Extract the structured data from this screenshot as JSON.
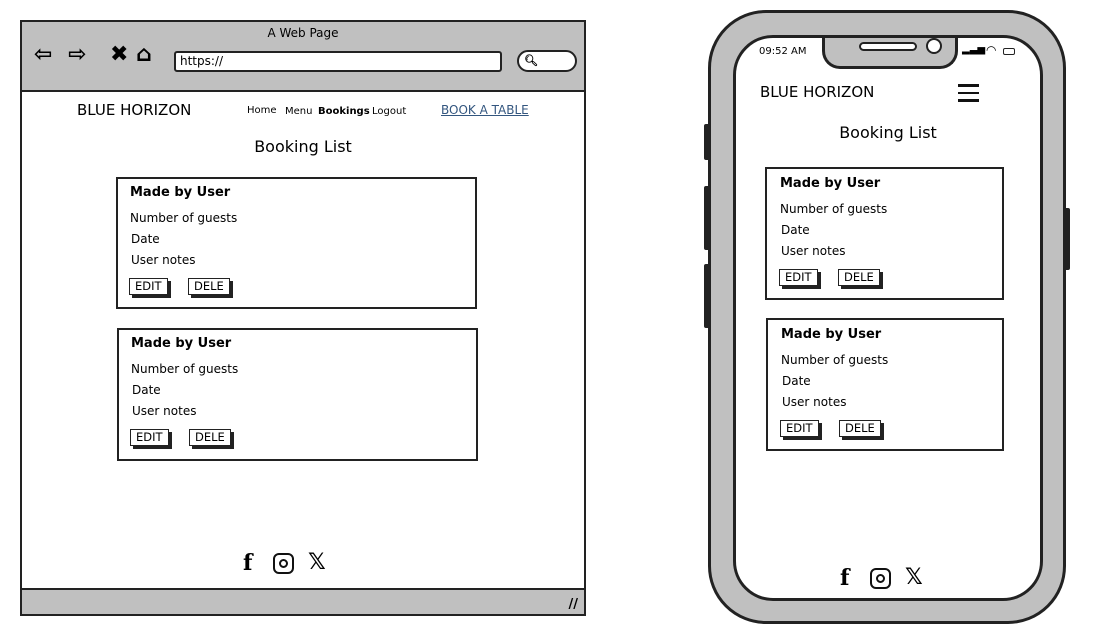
{
  "desktop": {
    "window_title": "A Web Page",
    "url": "https://",
    "nav": {
      "brand": "BLUE HORIZON",
      "links": [
        "Home",
        "Menu",
        "Bookings",
        "Logout"
      ],
      "cta": "BOOK A TABLE"
    },
    "page_title": "Booking List",
    "bookings": [
      {
        "title": "Made by User",
        "guests": "Number of guests",
        "date": "Date",
        "notes": "User notes",
        "edit": "EDIT",
        "delete": "DELE"
      },
      {
        "title": "Made by User",
        "guests": "Number of guests",
        "date": "Date",
        "notes": "User notes",
        "edit": "EDIT",
        "delete": "DELE"
      }
    ],
    "social": [
      "facebook-icon",
      "instagram-icon",
      "x-icon"
    ]
  },
  "mobile": {
    "status_time": "09:52 AM",
    "brand": "BLUE HORIZON",
    "page_title": "Booking List",
    "bookings": [
      {
        "title": "Made by User",
        "guests": "Number of guests",
        "date": "Date",
        "notes": "User notes",
        "edit": "EDIT",
        "delete": "DELE"
      },
      {
        "title": "Made by User",
        "guests": "Number of guests",
        "date": "Date",
        "notes": "User notes",
        "edit": "EDIT",
        "delete": "DELE"
      }
    ]
  },
  "colors": {
    "frame_gray": "#c0c0c0",
    "link_blue": "#33567f"
  }
}
